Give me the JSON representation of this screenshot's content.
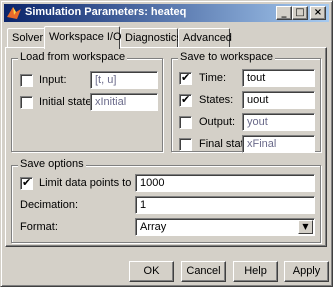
{
  "window": {
    "title": "Simulation Parameters: heateq"
  },
  "titlebar_buttons": {
    "minimize": "_",
    "maximize": "□",
    "close": "×"
  },
  "tabs": [
    "Solver",
    "Workspace I/O",
    "Diagnostics",
    "Advanced"
  ],
  "active_tab": "Workspace I/O",
  "load": {
    "title": "Load from workspace",
    "input": {
      "label": "Input:",
      "checked": false,
      "value": "[t, u]"
    },
    "initial_state": {
      "label": "Initial state:",
      "checked": false,
      "value": "xInitial"
    }
  },
  "save": {
    "title": "Save to workspace",
    "time": {
      "label": "Time:",
      "checked": true,
      "value": "tout"
    },
    "states": {
      "label": "States:",
      "checked": true,
      "value": "uout"
    },
    "output": {
      "label": "Output:",
      "checked": false,
      "value": "yout"
    },
    "final_state": {
      "label": "Final state:",
      "checked": false,
      "value": "xFinal"
    }
  },
  "options": {
    "title": "Save options",
    "limit": {
      "label": "Limit data points to last:",
      "checked": true,
      "value": "1000"
    },
    "decimation": {
      "label": "Decimation:",
      "value": "1"
    },
    "format": {
      "label": "Format:",
      "value": "Array"
    }
  },
  "buttons": {
    "ok": "OK",
    "cancel": "Cancel",
    "help": "Help",
    "apply": "Apply"
  },
  "glyphs": {
    "check": "✔",
    "dropdown": "▼"
  }
}
